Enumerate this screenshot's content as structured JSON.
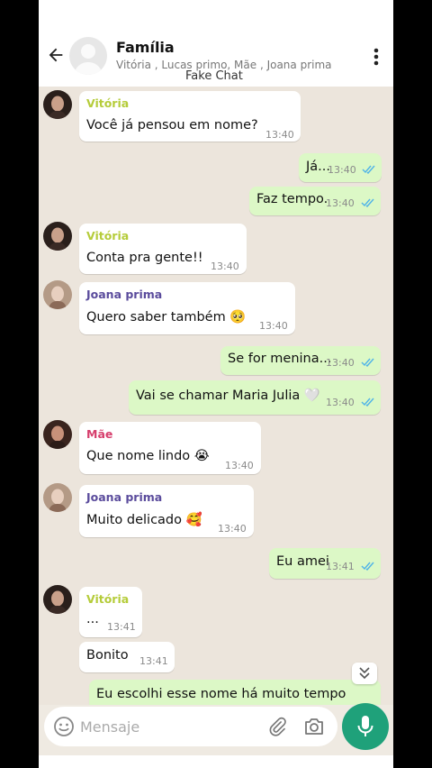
{
  "header": {
    "title": "Família",
    "participants": "Vitória , Lucas primo, Mãe , Joana prima",
    "watermark": "Fake Chat"
  },
  "colors": {
    "vitoria": "#b5cc3a",
    "joana": "#5a4b9c",
    "mae": "#d63e6c",
    "outgoing_bubble": "#dcf8c6",
    "read_ticks": "#4fb3e8",
    "accent": "#1fa17a"
  },
  "messages": [
    {
      "sender": "Vitória",
      "text": "Você já pensou em nome?",
      "time": "13:40"
    },
    {
      "text": "Já...",
      "time": "13:40"
    },
    {
      "text": "Faz tempo.",
      "time": "13:40"
    },
    {
      "sender": "Vitória",
      "text": "Conta pra gente!!",
      "time": "13:40"
    },
    {
      "sender": "Joana prima",
      "text": "Quero saber também 🥺",
      "time": "13:40"
    },
    {
      "text": "Se for menina...",
      "time": "13:40"
    },
    {
      "text": "Vai se chamar Maria Julia 🤍",
      "time": "13:40"
    },
    {
      "sender": "Mãe",
      "text": "Que nome lindo 😭",
      "time": "13:40"
    },
    {
      "sender": "Joana prima",
      "text": "Muito delicado 🥰",
      "time": "13:40"
    },
    {
      "text": "Eu amei",
      "time": "13:41"
    },
    {
      "sender": "Vitória",
      "text": "...",
      "time": "13:41"
    },
    {
      "text": "Bonito",
      "time": "13:41"
    },
    {
      "text": "Eu escolhi esse nome há muito tempo"
    }
  ],
  "input": {
    "placeholder": "Mensaje"
  },
  "icons": [
    "back-arrow-icon",
    "group-avatar-icon",
    "more-vert-icon",
    "emoji-icon",
    "attach-clip-icon",
    "camera-icon",
    "mic-icon",
    "chevron-double-down-icon",
    "read-ticks-icon"
  ]
}
